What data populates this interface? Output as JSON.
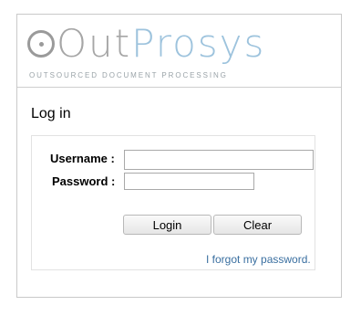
{
  "brand": {
    "logo_out": "Out",
    "logo_prosys": "Prosys",
    "tagline": "OUTSOURCED DOCUMENT PROCESSING",
    "colors": {
      "gray": "#a6a6a6",
      "blue": "#9dc3dd"
    }
  },
  "section": {
    "title": "Log in"
  },
  "form": {
    "username_label": "Username :",
    "username_value": "",
    "password_label": "Password :",
    "password_value": "",
    "login_button": "Login",
    "clear_button": "Clear",
    "forgot_link": "I forgot my password."
  }
}
